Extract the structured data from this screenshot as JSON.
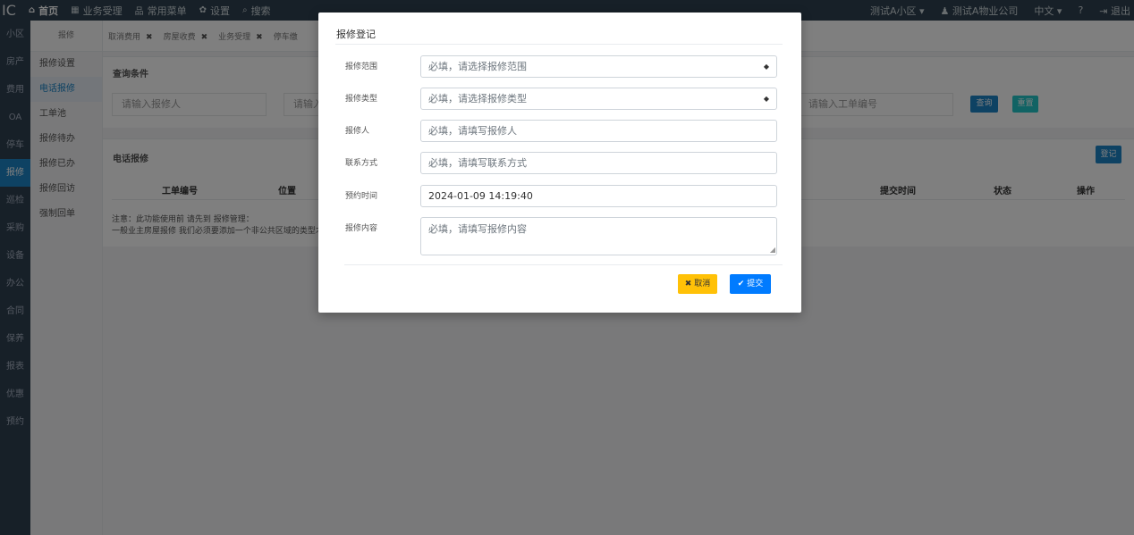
{
  "brand": "IC",
  "topnav": [
    {
      "icon": "home-icon",
      "glyph": "⌂",
      "label": "首页"
    },
    {
      "icon": "calculator-icon",
      "glyph": "▦",
      "label": "业务受理"
    },
    {
      "icon": "sitemap-icon",
      "glyph": "品",
      "label": "常用菜单"
    },
    {
      "icon": "gear-icon",
      "glyph": "✿",
      "label": "设置"
    },
    {
      "icon": "search-icon",
      "glyph": "⌕",
      "label": "搜索"
    }
  ],
  "topright": {
    "community": "测试A小区 ▾",
    "company": "♟ 测试A物业公司",
    "language": "中文 ▾",
    "help": "?",
    "logout": "⇥ 退出"
  },
  "leftcol": [
    "小区",
    "房产",
    "费用",
    "OA",
    "停车",
    "报修",
    "巡检",
    "采购",
    "设备",
    "办公",
    "合同",
    "保养",
    "报表",
    "优惠",
    "预约"
  ],
  "submenu": {
    "head": "报修",
    "items": [
      "报修设置",
      "电话报修",
      "工单池",
      "报修待办",
      "报修已办",
      "报修回访",
      "强制回单"
    ]
  },
  "tabs": [
    {
      "label": "取消费用",
      "close": "✖"
    },
    {
      "label": "房屋收费",
      "close": "✖"
    },
    {
      "label": "业务受理",
      "close": "✖"
    },
    {
      "label": "停车缴",
      "close": ""
    }
  ],
  "query": {
    "title": "查询条件",
    "repair_name_placeholder": "请输入报修人",
    "second_placeholder": "请输入",
    "order_no_placeholder": "请输入工单编号",
    "search_btn": "查询",
    "reset_btn": "重置"
  },
  "list": {
    "title": "电话报修",
    "register_btn": "登记",
    "columns": [
      "工单编号",
      "位置",
      "提交时间",
      "状态",
      "操作"
    ],
    "note_1": "注意：此功能使用前 请先到 报修管理：",
    "note_2": "一般业主房屋报修 我们必须要添加一个非公共区域的类型才"
  },
  "modal": {
    "title": "报修登记",
    "fields": {
      "scope": {
        "label": "报修范围",
        "placeholder": "必填，请选择报修范围"
      },
      "type": {
        "label": "报修类型",
        "placeholder": "必填，请选择报修类型"
      },
      "person": {
        "label": "报修人",
        "placeholder": "必填，请填写报修人"
      },
      "contact": {
        "label": "联系方式",
        "placeholder": "必填，请填写联系方式"
      },
      "time": {
        "label": "预约时间",
        "value": "2024-01-09 14:19:40"
      },
      "content": {
        "label": "报修内容",
        "placeholder": "必填，请填写报修内容"
      }
    },
    "cancel": "✖ 取消",
    "submit": "✔ 提交"
  },
  "colors": {
    "topbar": "#2f4050",
    "primary": "#1c84c6",
    "teal": "#23c6c8",
    "warning": "#ffc107",
    "submit": "#007bff"
  }
}
